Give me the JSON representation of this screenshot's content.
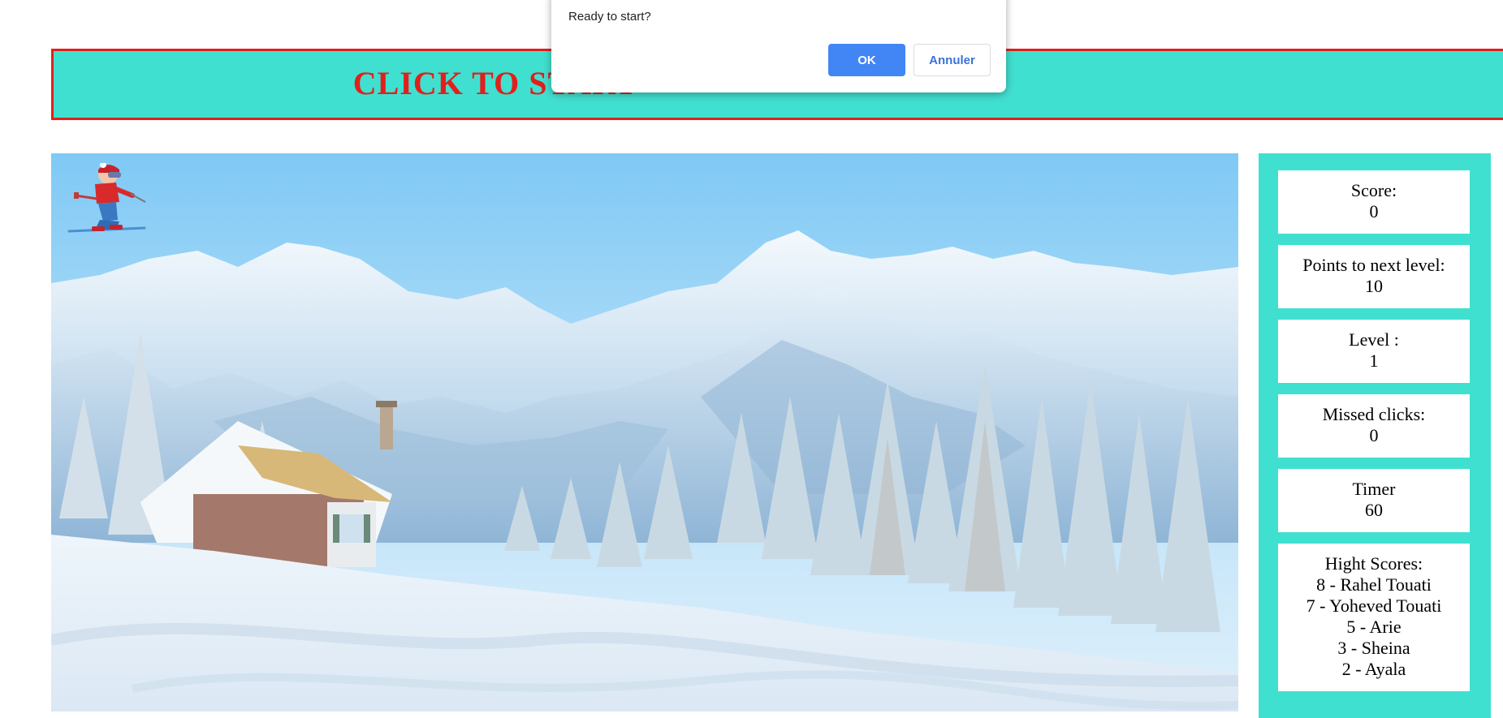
{
  "banner": {
    "label": "CLICK TO START"
  },
  "dialog": {
    "message": "Ready to start?",
    "ok_label": "OK",
    "cancel_label": "Annuler"
  },
  "stats": {
    "score_label": "Score:",
    "score_value": "0",
    "points_label": "Points to next level:",
    "points_value": "10",
    "level_label": "Level :",
    "level_value": "1",
    "missed_label": "Missed clicks:",
    "missed_value": "0",
    "timer_label": "Timer",
    "timer_value": "60",
    "highscores_label": "Hight Scores:",
    "highscores": [
      "8 - Rahel Touati",
      "7 - Yoheved Touati",
      "5 - Arie",
      "3 - Sheina",
      "2 - Ayala"
    ]
  },
  "colors": {
    "panel": "#40e0d0",
    "banner_border": "#e0201c",
    "banner_text": "#e0201c",
    "ok_button": "#4285f4"
  },
  "icons": {
    "skier": "skier-icon"
  },
  "scene": {
    "description_icon": "winter-mountain-scene"
  }
}
